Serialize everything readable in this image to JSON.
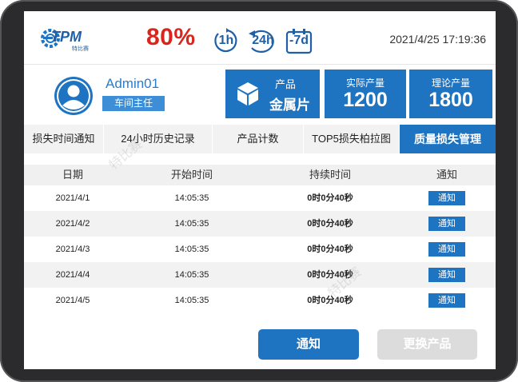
{
  "header": {
    "logo_text": "TPM",
    "logo_subtext": "特比赛",
    "efficiency": "80%",
    "ranges": [
      "1h",
      "24h",
      "-7d"
    ],
    "datetime": "2021/4/25 17:19:36"
  },
  "user": {
    "name": "Admin01",
    "role": "车间主任"
  },
  "cards": {
    "product": {
      "label": "产品",
      "value": "金属片"
    },
    "actual": {
      "label": "实际产量",
      "value": "1200"
    },
    "theory": {
      "label": "理论产量",
      "value": "1800"
    }
  },
  "tabs": [
    "损失时间通知",
    "24小时历史记录",
    "产品计数",
    "TOP5损失柏拉图",
    "质量损失管理"
  ],
  "table": {
    "headers": [
      "日期",
      "开始时间",
      "持续时间",
      "通知"
    ],
    "rows": [
      {
        "date": "2021/4/1",
        "start": "14:05:35",
        "duration": "0时0分40秒",
        "action": "通知"
      },
      {
        "date": "2021/4/2",
        "start": "14:05:35",
        "duration": "0时0分40秒",
        "action": "通知"
      },
      {
        "date": "2021/4/3",
        "start": "14:05:35",
        "duration": "0时0分40秒",
        "action": "通知"
      },
      {
        "date": "2021/4/4",
        "start": "14:05:35",
        "duration": "0时0分40秒",
        "action": "通知"
      },
      {
        "date": "2021/4/5",
        "start": "14:05:35",
        "duration": "0时0分40秒",
        "action": "通知"
      }
    ]
  },
  "buttons": {
    "notify": "通知",
    "change_product": "更换产品"
  },
  "watermark": "特比赛",
  "colors": {
    "primary": "#1f74c2",
    "efficiency": "#d9261c",
    "disabled": "#dcdcdc"
  }
}
